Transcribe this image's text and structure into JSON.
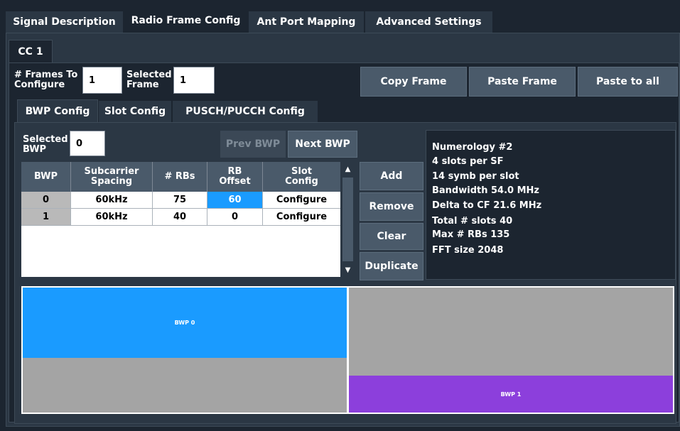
{
  "main_tabs": [
    "Signal Description",
    "Radio Frame Config",
    "Ant Port Mapping",
    "Advanced Settings"
  ],
  "cc_tab": "CC 1",
  "frames_to_configure": {
    "label_line1": "# Frames To",
    "label_line2": "Configure",
    "value": "1"
  },
  "selected_frame": {
    "label_line1": "Selected",
    "label_line2": "Frame",
    "value": "1"
  },
  "frame_buttons": {
    "copy": "Copy Frame",
    "paste": "Paste Frame",
    "paste_all": "Paste to all"
  },
  "sub_tabs": [
    "BWP Config",
    "Slot Config",
    "PUSCH/PUCCH Config"
  ],
  "selected_bwp": {
    "label_line1": "Selected",
    "label_line2": "BWP",
    "value": "0"
  },
  "bwp_nav": {
    "prev": "Prev BWP",
    "next": "Next BWP"
  },
  "table": {
    "headers": [
      {
        "l1": "BWP",
        "l2": ""
      },
      {
        "l1": "Subcarrier",
        "l2": "Spacing"
      },
      {
        "l1": "# RBs",
        "l2": ""
      },
      {
        "l1": "RB",
        "l2": "Offset"
      },
      {
        "l1": "Slot",
        "l2": "Config"
      }
    ],
    "rows": [
      {
        "bwp": "0",
        "scs": "60kHz",
        "rbs": "75",
        "offset": "60",
        "slot": "Configure"
      },
      {
        "bwp": "1",
        "scs": "60kHz",
        "rbs": "40",
        "offset": "0",
        "slot": "Configure"
      }
    ]
  },
  "side_buttons": {
    "add": "Add",
    "remove": "Remove",
    "clear": "Clear",
    "duplicate": "Duplicate"
  },
  "info": [
    "Numerology #2",
    "4 slots per SF",
    "14 symb per slot",
    "Bandwidth 54.0 MHz",
    "Delta to CF 21.6 MHz",
    "Total # slots 40",
    "Max # RBs 135",
    "FFT size 2048"
  ],
  "viz": {
    "bwp0_label": "BWP 0",
    "bwp1_label": "BWP 1"
  },
  "colors": {
    "bwp0": "#1a9bff",
    "bwp1": "#8c3fdc",
    "selected_cell": "#1a9bff"
  }
}
